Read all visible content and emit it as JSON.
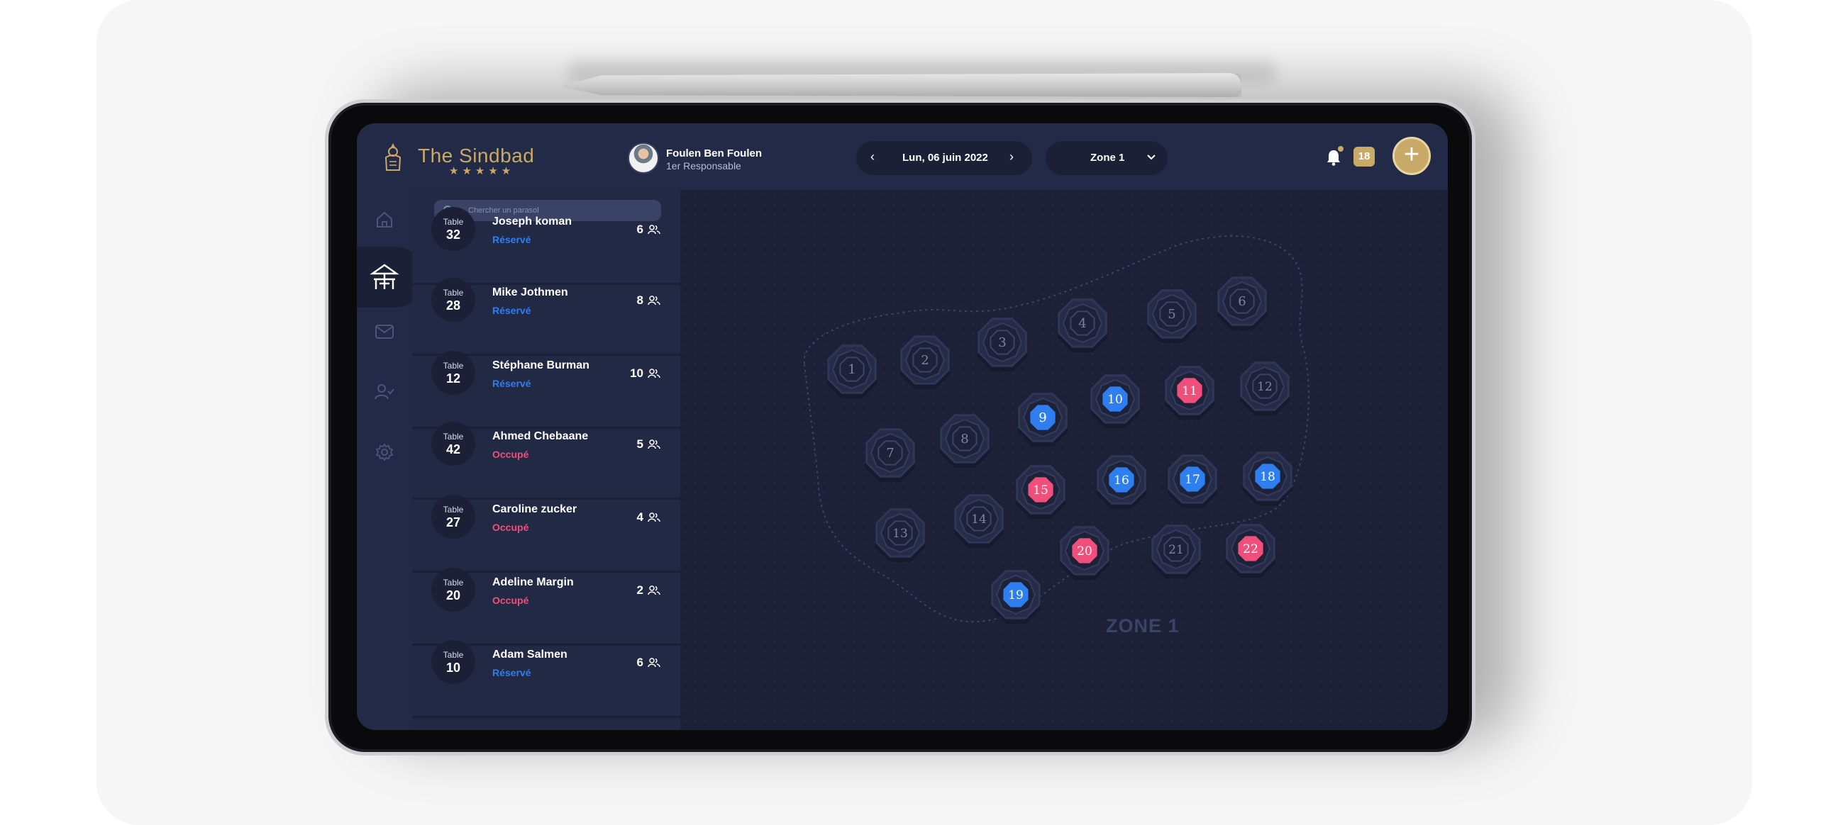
{
  "app": {
    "brand": "The Sindbad",
    "stars": "★★★★★"
  },
  "user": {
    "name": "Foulen Ben Foulen",
    "role": "1er Responsable"
  },
  "date_selector": {
    "value": "Lun, 06 juin 2022"
  },
  "zone_selector": {
    "value": "Zone 1"
  },
  "notifications": {
    "count": "18"
  },
  "nav": {
    "items": [
      {
        "name": "home",
        "icon": "home-icon",
        "active": false
      },
      {
        "name": "parasol",
        "icon": "parasol-table-icon",
        "active": true
      },
      {
        "name": "messages",
        "icon": "mail-icon",
        "active": false
      },
      {
        "name": "users",
        "icon": "user-check-icon",
        "active": false
      },
      {
        "name": "settings",
        "icon": "gear-icon",
        "active": false
      }
    ]
  },
  "search": {
    "placeholder": "Chercher un parasol"
  },
  "reservations": [
    {
      "table_label": "Table",
      "table": "32",
      "name": "Joseph koman",
      "status": "Réservé",
      "status_type": "reserved",
      "guests": "6"
    },
    {
      "table_label": "Table",
      "table": "28",
      "name": "Mike Jothmen",
      "status": "Réservé",
      "status_type": "reserved",
      "guests": "8"
    },
    {
      "table_label": "Table",
      "table": "12",
      "name": "Stéphane Burman",
      "status": "Réservé",
      "status_type": "reserved",
      "guests": "10"
    },
    {
      "table_label": "Table",
      "table": "42",
      "name": "Ahmed Chebaane",
      "status": "Occupé",
      "status_type": "occupied",
      "guests": "5"
    },
    {
      "table_label": "Table",
      "table": "27",
      "name": "Caroline zucker",
      "status": "Occupé",
      "status_type": "occupied",
      "guests": "4"
    },
    {
      "table_label": "Table",
      "table": "20",
      "name": "Adeline Margin",
      "status": "Occupé",
      "status_type": "occupied",
      "guests": "2"
    },
    {
      "table_label": "Table",
      "table": "10",
      "name": "Adam Salmen",
      "status": "Réservé",
      "status_type": "reserved",
      "guests": "6"
    }
  ],
  "map": {
    "zone_label": "ZONE 1",
    "tables": [
      {
        "number": "1",
        "state": "free"
      },
      {
        "number": "2",
        "state": "free"
      },
      {
        "number": "3",
        "state": "free"
      },
      {
        "number": "4",
        "state": "free"
      },
      {
        "number": "5",
        "state": "free"
      },
      {
        "number": "6",
        "state": "free"
      },
      {
        "number": "7",
        "state": "free"
      },
      {
        "number": "8",
        "state": "free"
      },
      {
        "number": "9",
        "state": "reserved"
      },
      {
        "number": "10",
        "state": "reserved"
      },
      {
        "number": "11",
        "state": "occupied"
      },
      {
        "number": "12",
        "state": "free"
      },
      {
        "number": "13",
        "state": "free"
      },
      {
        "number": "14",
        "state": "free"
      },
      {
        "number": "15",
        "state": "occupied"
      },
      {
        "number": "16",
        "state": "reserved"
      },
      {
        "number": "17",
        "state": "reserved"
      },
      {
        "number": "18",
        "state": "reserved"
      },
      {
        "number": "19",
        "state": "reserved"
      },
      {
        "number": "20",
        "state": "occupied"
      },
      {
        "number": "21",
        "state": "free"
      },
      {
        "number": "22",
        "state": "occupied"
      }
    ]
  },
  "colors": {
    "gold": "#c9a967",
    "reserved": "#2f7ef0",
    "occupied": "#ef4f7a",
    "free_ring": "#2e3554"
  }
}
